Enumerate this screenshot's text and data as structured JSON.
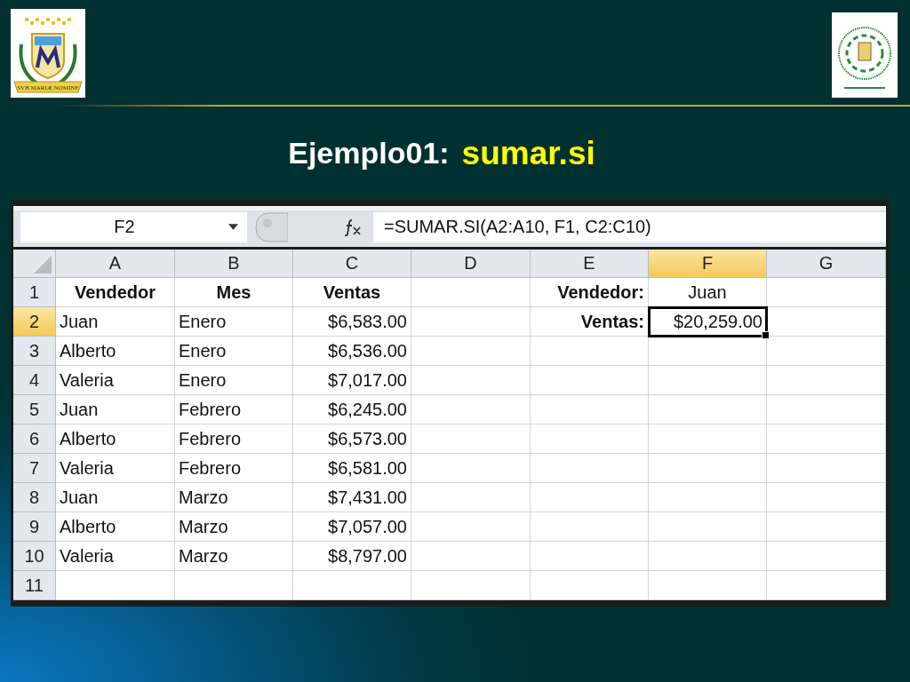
{
  "logos": {
    "left": {
      "ribbon": "SVB MARIÆ NOMINE"
    }
  },
  "title": {
    "prefix": "Ejemplo01:",
    "highlight": "sumar.si"
  },
  "sheet": {
    "name_box": "F2",
    "formula": "=SUMAR.SI(A2:A10, F1, C2:C10)",
    "columns": [
      {
        "label": "A",
        "selected": false
      },
      {
        "label": "B",
        "selected": false
      },
      {
        "label": "C",
        "selected": false
      },
      {
        "label": "D",
        "selected": false
      },
      {
        "label": "E",
        "selected": false
      },
      {
        "label": "F",
        "selected": true
      },
      {
        "label": "G",
        "selected": false
      }
    ],
    "rows": [
      {
        "number": "1",
        "selected": false,
        "cells": [
          {
            "text": "Vendedor",
            "kind": "header",
            "selected": false
          },
          {
            "text": "Mes",
            "kind": "header",
            "selected": false
          },
          {
            "text": "Ventas",
            "kind": "header",
            "selected": false
          },
          null,
          {
            "text": "Vendedor:",
            "kind": "label",
            "selected": false
          },
          {
            "text": "Juan",
            "kind": "center",
            "selected": false
          },
          null
        ]
      },
      {
        "number": "2",
        "selected": true,
        "cells": [
          {
            "text": "Juan",
            "kind": "text",
            "selected": false
          },
          {
            "text": "Enero",
            "kind": "text",
            "selected": false
          },
          {
            "text": "$6,583.00",
            "kind": "number",
            "selected": false
          },
          null,
          {
            "text": "Ventas:",
            "kind": "label",
            "selected": false
          },
          {
            "text": "$20,259.00",
            "kind": "number",
            "selected": true
          },
          null
        ]
      },
      {
        "number": "3",
        "selected": false,
        "cells": [
          {
            "text": "Alberto",
            "kind": "text",
            "selected": false
          },
          {
            "text": "Enero",
            "kind": "text",
            "selected": false
          },
          {
            "text": "$6,536.00",
            "kind": "number",
            "selected": false
          },
          null,
          null,
          null,
          null
        ]
      },
      {
        "number": "4",
        "selected": false,
        "cells": [
          {
            "text": "Valeria",
            "kind": "text",
            "selected": false
          },
          {
            "text": "Enero",
            "kind": "text",
            "selected": false
          },
          {
            "text": "$7,017.00",
            "kind": "number",
            "selected": false
          },
          null,
          null,
          null,
          null
        ]
      },
      {
        "number": "5",
        "selected": false,
        "cells": [
          {
            "text": "Juan",
            "kind": "text",
            "selected": false
          },
          {
            "text": "Febrero",
            "kind": "text",
            "selected": false
          },
          {
            "text": "$6,245.00",
            "kind": "number",
            "selected": false
          },
          null,
          null,
          null,
          null
        ]
      },
      {
        "number": "6",
        "selected": false,
        "cells": [
          {
            "text": "Alberto",
            "kind": "text",
            "selected": false
          },
          {
            "text": "Febrero",
            "kind": "text",
            "selected": false
          },
          {
            "text": "$6,573.00",
            "kind": "number",
            "selected": false
          },
          null,
          null,
          null,
          null
        ]
      },
      {
        "number": "7",
        "selected": false,
        "cells": [
          {
            "text": "Valeria",
            "kind": "text",
            "selected": false
          },
          {
            "text": "Febrero",
            "kind": "text",
            "selected": false
          },
          {
            "text": "$6,581.00",
            "kind": "number",
            "selected": false
          },
          null,
          null,
          null,
          null
        ]
      },
      {
        "number": "8",
        "selected": false,
        "cells": [
          {
            "text": "Juan",
            "kind": "text",
            "selected": false
          },
          {
            "text": "Marzo",
            "kind": "text",
            "selected": false
          },
          {
            "text": "$7,431.00",
            "kind": "number",
            "selected": false
          },
          null,
          null,
          null,
          null
        ]
      },
      {
        "number": "9",
        "selected": false,
        "cells": [
          {
            "text": "Alberto",
            "kind": "text",
            "selected": false
          },
          {
            "text": "Marzo",
            "kind": "text",
            "selected": false
          },
          {
            "text": "$7,057.00",
            "kind": "number",
            "selected": false
          },
          null,
          null,
          null,
          null
        ]
      },
      {
        "number": "10",
        "selected": false,
        "cells": [
          {
            "text": "Valeria",
            "kind": "text",
            "selected": false
          },
          {
            "text": "Marzo",
            "kind": "text",
            "selected": false
          },
          {
            "text": "$8,797.00",
            "kind": "number",
            "selected": false
          },
          null,
          null,
          null,
          null
        ]
      },
      {
        "number": "11",
        "selected": false,
        "cells": [
          null,
          null,
          null,
          null,
          null,
          null,
          null
        ]
      }
    ]
  }
}
